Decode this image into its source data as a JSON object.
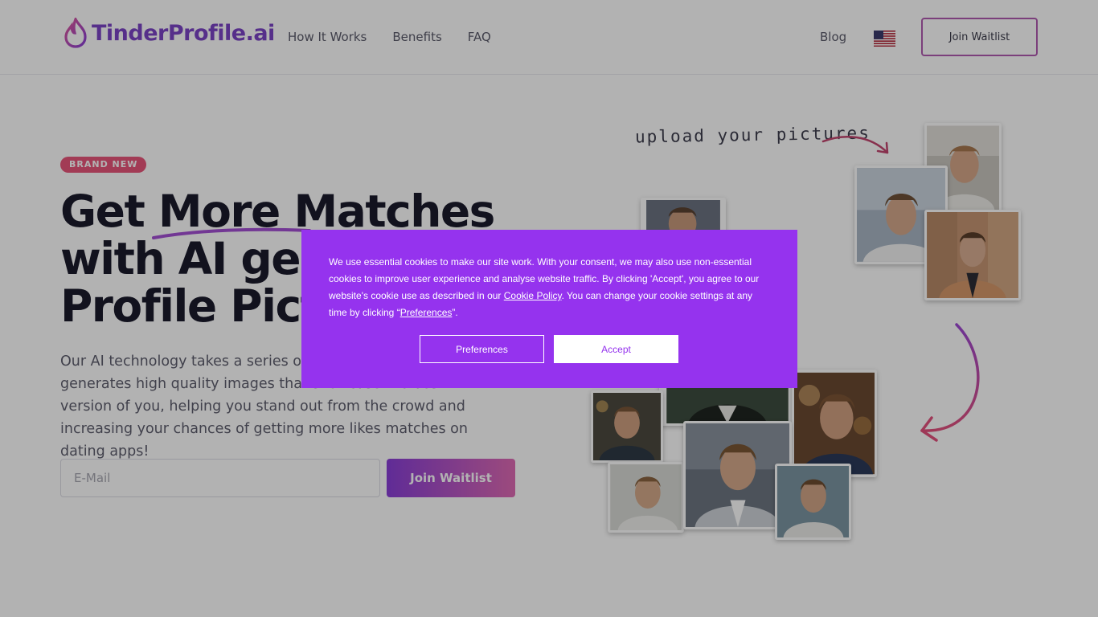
{
  "header": {
    "logo_text": "TinderProfile.ai",
    "nav": [
      "How It Works",
      "Benefits",
      "FAQ"
    ],
    "blog": "Blog",
    "flag_icon": "us-flag-icon",
    "join_button": "Join Waitlist"
  },
  "hero": {
    "badge": "BRAND NEW",
    "headline": [
      "Get More Matches",
      "with AI generated",
      "Profile Pictures"
    ],
    "description": "Our AI technology takes a series of your photos and generates high quality images that showcase the best version of you, helping you stand out from the crowd and increasing your chances of getting more likes matches on dating apps!",
    "email_placeholder": "E-Mail",
    "join_button": "Join Waitlist"
  },
  "collage": {
    "upload_label": "upload your pictures"
  },
  "cookie": {
    "text_before": "We use essential cookies to make our site work. With your consent, we may also use non-essential cookies to improve user experience and analyse website traffic. By clicking 'Accept', you agree to our website's cookie use as described in our ",
    "cookie_policy_link": "Cookie Policy",
    "text_middle": ". You can change your cookie settings at any time by clicking “",
    "preferences_link": "Preferences",
    "text_after": "”.",
    "preferences_button": "Preferences",
    "accept_button": "Accept"
  },
  "colors": {
    "brand_purple": "#9533ee",
    "badge_pink": "#e9557a",
    "gradient_start": "#8a3fd8",
    "gradient_end": "#e06bb4"
  }
}
